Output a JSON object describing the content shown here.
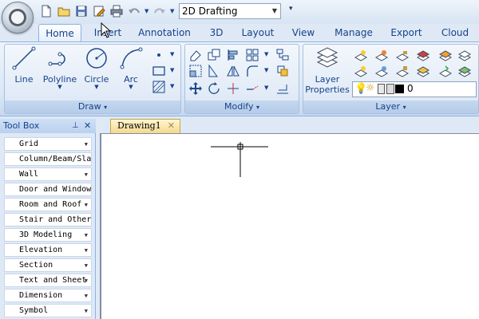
{
  "qat": {
    "workspace": "2D Drafting"
  },
  "tabs": [
    "Home",
    "Insert",
    "Annotation",
    "3D",
    "Layout",
    "View",
    "Manage",
    "Export",
    "Cloud"
  ],
  "ribbon": {
    "draw": {
      "title": "Draw",
      "buttons": [
        "Line",
        "Polyline",
        "Circle",
        "Arc"
      ]
    },
    "modify": {
      "title": "Modify"
    },
    "layer": {
      "title": "Layer",
      "properties_line1": "Layer",
      "properties_line2": "Properties",
      "current_layer": "0"
    }
  },
  "toolbox": {
    "title": "Tool Box",
    "items": [
      {
        "label": "Grid",
        "dropdown": true
      },
      {
        "label": "Column/Beam/Sla",
        "dropdown": false
      },
      {
        "label": "Wall",
        "dropdown": true
      },
      {
        "label": "Door and Window",
        "dropdown": false
      },
      {
        "label": "Room and Roof",
        "dropdown": true
      },
      {
        "label": "Stair and Other",
        "dropdown": false
      },
      {
        "label": "3D Modeling",
        "dropdown": true
      },
      {
        "label": "Elevation",
        "dropdown": true
      },
      {
        "label": "Section",
        "dropdown": true
      },
      {
        "label": "Text and Sheet",
        "dropdown": true
      },
      {
        "label": "Dimension",
        "dropdown": true
      },
      {
        "label": "Symbol",
        "dropdown": true
      }
    ]
  },
  "document": {
    "tab": "Drawing1"
  }
}
